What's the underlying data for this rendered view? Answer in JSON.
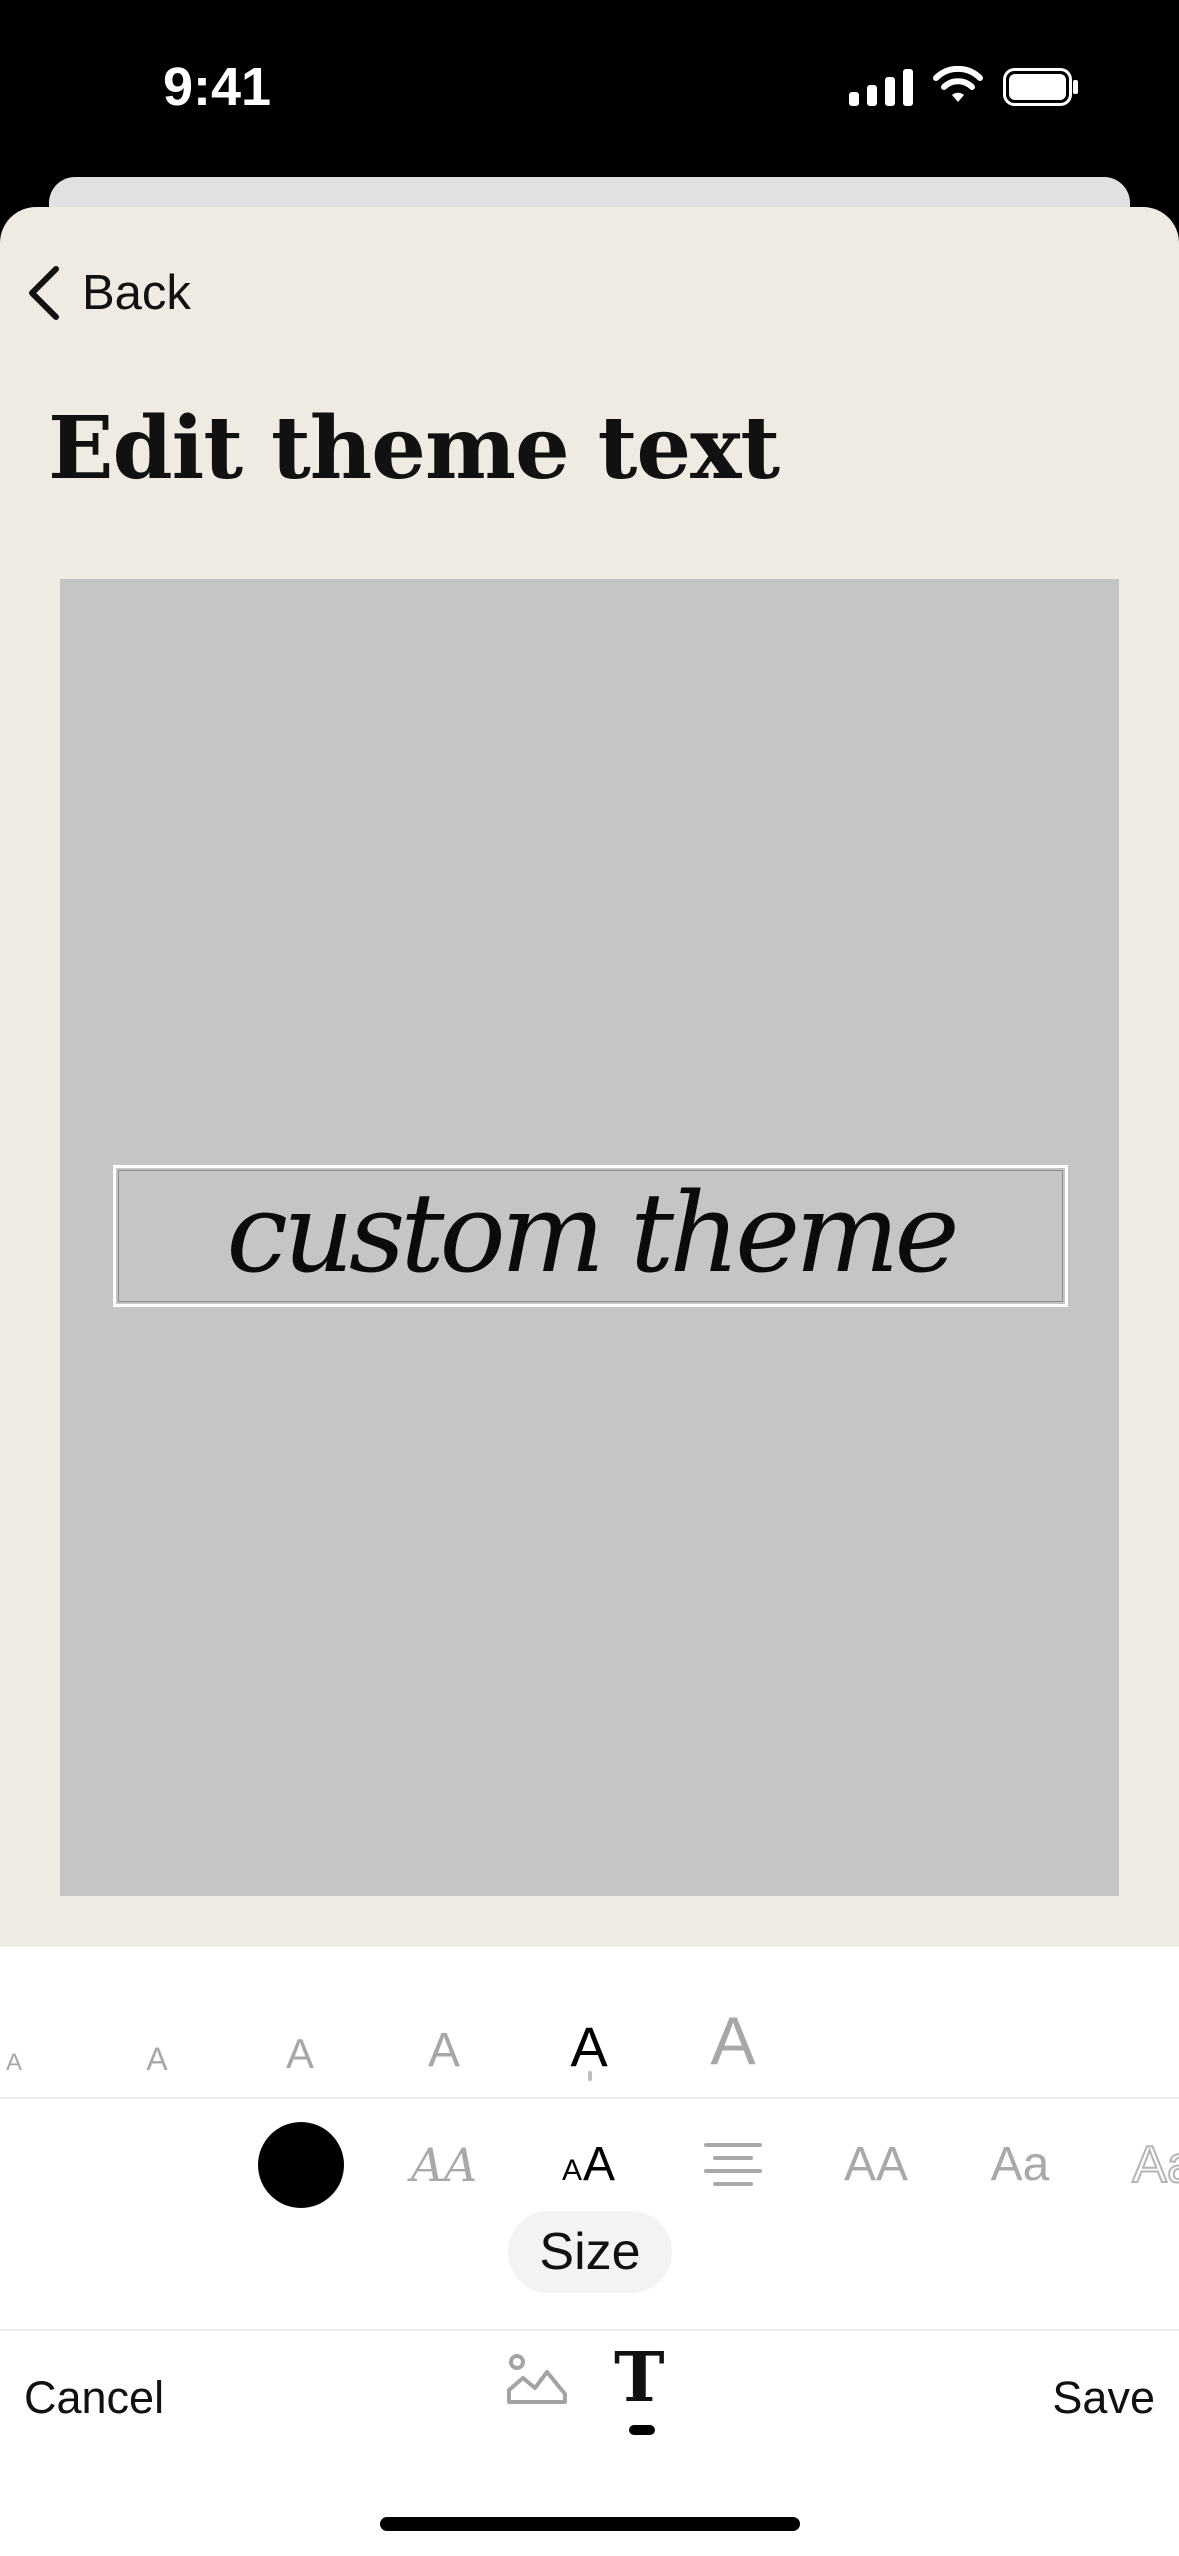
{
  "status_bar": {
    "time": "9:41"
  },
  "header": {
    "back_label": "Back",
    "title": "Edit theme text"
  },
  "preview": {
    "theme_text": "custom theme"
  },
  "size_options": [
    {
      "label": "A",
      "selected": false
    },
    {
      "label": "A",
      "selected": false
    },
    {
      "label": "A",
      "selected": false
    },
    {
      "label": "A",
      "selected": false
    },
    {
      "label": "A",
      "selected": true
    },
    {
      "label": "A",
      "selected": false
    }
  ],
  "style_tools": {
    "color": "#000000",
    "font_style_label": "AA",
    "size_label": "AA",
    "case_upper_label": "AA",
    "case_mixed_label": "Aa",
    "outline_label": "Aa",
    "active_tool": "Size"
  },
  "toolbar": {
    "cancel_label": "Cancel",
    "save_label": "Save",
    "text_tool_label": "T",
    "active_tab": "text"
  },
  "icons": [
    "signal-icon",
    "wifi-icon",
    "battery-icon",
    "chevron-left-icon",
    "color-swatch-icon",
    "font-icon",
    "text-size-icon",
    "align-center-icon",
    "uppercase-icon",
    "mixed-case-icon",
    "outline-text-icon",
    "image-icon",
    "text-icon"
  ]
}
